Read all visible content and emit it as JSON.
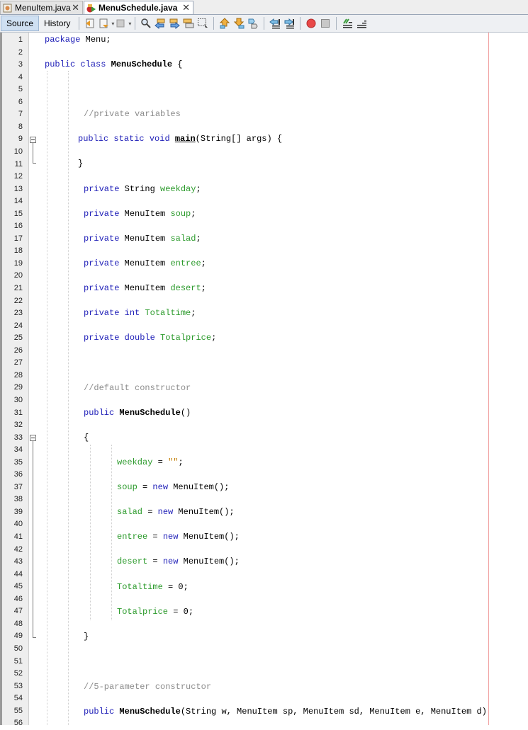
{
  "tabs": [
    {
      "label": "MenuItem.java",
      "active": false,
      "icon": "java-file-icon"
    },
    {
      "label": "MenuSchedule.java",
      "active": true,
      "icon": "java-main-class-icon"
    }
  ],
  "toolbar": {
    "source_label": "Source",
    "history_label": "History",
    "icons": [
      "last-edit-icon",
      "back-icon",
      "forward-icon",
      "find-selection-icon",
      "find-previous-icon",
      "find-next-icon",
      "toggle-highlight-icon",
      "toggle-rect-selection-icon",
      "previous-bookmark-icon",
      "next-bookmark-icon",
      "toggle-bookmark-icon",
      "shift-left-icon",
      "shift-right-icon",
      "start-macro-icon",
      "stop-macro-icon",
      "comment-icon",
      "uncomment-icon"
    ]
  },
  "editor": {
    "line_numbers": [
      "1",
      "2",
      "3",
      "4",
      "5",
      "6",
      "7",
      "8",
      "9",
      "10",
      "11",
      "12",
      "13",
      "14",
      "15",
      "16",
      "17",
      "18",
      "19",
      "20",
      "21",
      "22",
      "23",
      "24",
      "25",
      "26",
      "27",
      "28",
      "29",
      "30",
      "31",
      "32",
      "33",
      "34",
      "35",
      "36",
      "37",
      "38",
      "39",
      "40",
      "41",
      "42",
      "43",
      "44",
      "45",
      "46",
      "47",
      "48",
      "49",
      "50",
      "51",
      "52",
      "53",
      "54",
      "55",
      "56"
    ],
    "lines": {
      "l1": {
        "kw": "package",
        "rest": " Menu;"
      },
      "l3": {
        "kw1": "public",
        "kw2": "class",
        "name": "MenuSchedule",
        "rest": " {"
      },
      "l7": {
        "comment": "//private variables"
      },
      "l9": {
        "kw1": "public",
        "kw2": "static",
        "kw3": "void",
        "name": "main",
        "rest": "(String[] args) {"
      },
      "l11": {
        "text": "}"
      },
      "l13": {
        "kw": "private",
        "type": " String ",
        "field": "weekday",
        "end": ";"
      },
      "l15": {
        "kw": "private",
        "type": " MenuItem ",
        "field": "soup",
        "end": ";"
      },
      "l17": {
        "kw": "private",
        "type": " MenuItem ",
        "field": "salad",
        "end": ";"
      },
      "l19": {
        "kw": "private",
        "type": " MenuItem ",
        "field": "entree",
        "end": ";"
      },
      "l21": {
        "kw": "private",
        "type": " MenuItem ",
        "field": "desert",
        "end": ";"
      },
      "l23": {
        "kw": "private",
        "type": "int",
        "field": "Totaltime",
        "end": ";"
      },
      "l25": {
        "kw": "private",
        "type": "double",
        "field": "Totalprice",
        "end": ";"
      },
      "l29": {
        "comment": "//default constructor"
      },
      "l31": {
        "kw": "public",
        "name": "MenuSchedule",
        "rest": "()"
      },
      "l33": {
        "text": "{"
      },
      "l35": {
        "field": "weekday",
        "op": " = ",
        "str": "\"\"",
        "end": ";"
      },
      "l37": {
        "field": "soup",
        "op": " = ",
        "kw": "new",
        "rest": " MenuItem();"
      },
      "l39": {
        "field": "salad",
        "op": " = ",
        "kw": "new",
        "rest": " MenuItem();"
      },
      "l41": {
        "field": "entree",
        "op": " = ",
        "kw": "new",
        "rest": " MenuItem();"
      },
      "l43": {
        "field": "desert",
        "op": " = ",
        "kw": "new",
        "rest": " MenuItem();"
      },
      "l45": {
        "field": "Totaltime",
        "rest": " = 0;"
      },
      "l47": {
        "field": "Totalprice",
        "rest": " = 0;"
      },
      "l49": {
        "text": "}"
      },
      "l53": {
        "comment": "//5-parameter constructor"
      },
      "l55": {
        "kw": "public",
        "name": "MenuSchedule",
        "rest": "(String w, MenuItem sp, MenuItem sd, MenuItem e, MenuItem d)"
      }
    }
  }
}
